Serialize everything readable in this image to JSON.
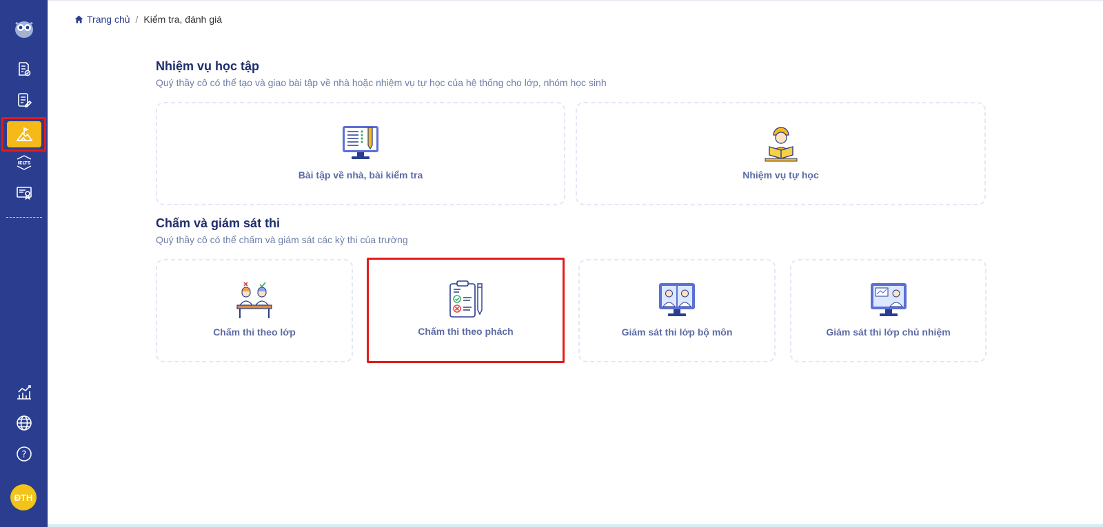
{
  "breadcrumb": {
    "home_label": "Trang chủ",
    "separator": "/",
    "current": "Kiểm tra, đánh giá"
  },
  "sidebar": {
    "items": [
      {
        "icon": "logo-owl-icon"
      },
      {
        "icon": "exam-list-icon"
      },
      {
        "icon": "document-edit-icon"
      },
      {
        "icon": "mountain-flag-icon",
        "active": true
      },
      {
        "icon": "ielts-icon",
        "label": "IELTS"
      },
      {
        "icon": "certificate-icon"
      },
      {
        "icon": "chart-icon"
      },
      {
        "icon": "globe-icon"
      },
      {
        "icon": "help-icon",
        "label": "?"
      }
    ],
    "avatar_initials": "ĐTH",
    "accent": "#f6b91a",
    "background": "#2a3d8f"
  },
  "sections": {
    "tasks": {
      "title": "Nhiệm vụ học tập",
      "subtitle": "Quý thầy cô có thể tạo và giao bài tập về nhà hoặc nhiệm vụ tự học của hệ thống cho lớp, nhóm học sinh",
      "cards": [
        {
          "label": "Bài tập về nhà, bài kiểm tra",
          "icon": "monitor-checklist-icon"
        },
        {
          "label": "Nhiệm vụ tự học",
          "icon": "student-reading-icon"
        }
      ]
    },
    "grading": {
      "title": "Chấm và giám sát thi",
      "subtitle": "Quý thầy cô có thể chấm và giám sát các kỳ thi của trường",
      "cards": [
        {
          "label": "Chấm thi theo lớp",
          "icon": "students-desk-icon"
        },
        {
          "label": "Chấm thi theo phách",
          "icon": "clipboard-grading-icon",
          "highlighted": true
        },
        {
          "label": "Giám sát thi lớp bộ môn",
          "icon": "monitor-students-icon"
        },
        {
          "label": "Giám sát thi lớp chủ nhiệm",
          "icon": "monitor-teacher-icon"
        }
      ]
    }
  },
  "colors": {
    "highlight_border": "#e21b1b",
    "title": "#1f2e6b",
    "card_label": "#5d6ba4"
  }
}
